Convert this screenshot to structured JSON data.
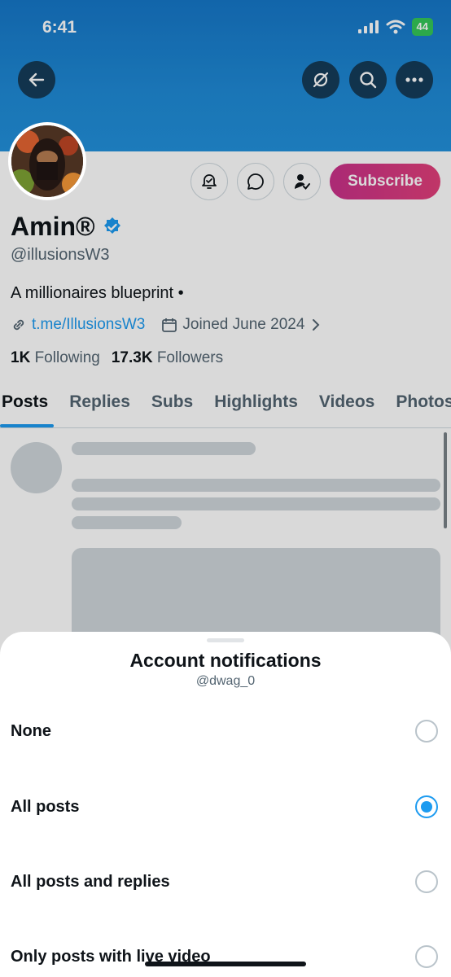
{
  "status_bar": {
    "time": "6:41",
    "battery": "44"
  },
  "profile": {
    "name": "Amin®",
    "handle": "@illusionsW3",
    "bio": "A millionaires blueprint •",
    "link": "t.me/IllusionsW3",
    "joined": "Joined June 2024",
    "following_count": "1K",
    "following_label": "Following",
    "followers_count": "17.3K",
    "followers_label": "Followers",
    "subscribe_label": "Subscribe"
  },
  "tabs": [
    {
      "label": "Posts"
    },
    {
      "label": "Replies"
    },
    {
      "label": "Subs"
    },
    {
      "label": "Highlights"
    },
    {
      "label": "Videos"
    },
    {
      "label": "Photos"
    }
  ],
  "sheet": {
    "title": "Account notifications",
    "subtitle": "@dwag_0",
    "options": [
      {
        "label": "None",
        "selected": false
      },
      {
        "label": "All posts",
        "selected": true
      },
      {
        "label": "All posts and replies",
        "selected": false
      },
      {
        "label": "Only posts with live video",
        "selected": false
      }
    ]
  },
  "colors": {
    "accent": "#1d9bf0",
    "banner": "#1f8ad6",
    "subscribe": "#d6377f"
  },
  "icons": [
    "back-arrow-icon",
    "grok-icon",
    "search-icon",
    "more-icon",
    "notification-bell-icon",
    "message-icon",
    "following-icon",
    "verified-badge-icon",
    "link-icon",
    "calendar-icon",
    "chevron-right-icon"
  ]
}
